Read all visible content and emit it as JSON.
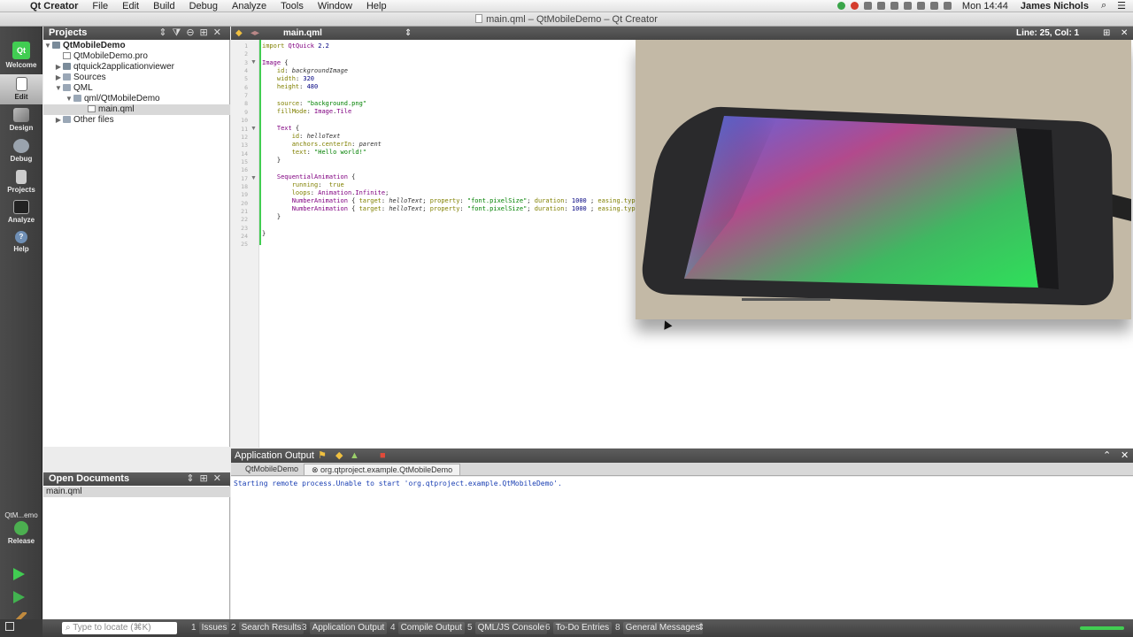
{
  "menubar": {
    "app": "Qt Creator",
    "items": [
      "File",
      "Edit",
      "Build",
      "Debug",
      "Analyze",
      "Tools",
      "Window",
      "Help"
    ],
    "clock": "Mon 14:44",
    "user": "James Nichols"
  },
  "window": {
    "title": "main.qml – QtMobileDemo – Qt Creator"
  },
  "modes": [
    {
      "label": "Welcome"
    },
    {
      "label": "Edit"
    },
    {
      "label": "Design"
    },
    {
      "label": "Debug"
    },
    {
      "label": "Projects"
    },
    {
      "label": "Analyze"
    },
    {
      "label": "Help"
    }
  ],
  "kit": {
    "project": "QtM...emo",
    "config": "Release"
  },
  "projects_pane": {
    "title": "Projects",
    "tree": [
      {
        "label": "QtMobileDemo",
        "bold": true
      },
      {
        "label": "QtMobileDemo.pro"
      },
      {
        "label": "qtquick2applicationviewer"
      },
      {
        "label": "Sources"
      },
      {
        "label": "QML"
      },
      {
        "label": "qml/QtMobileDemo"
      },
      {
        "label": "main.qml"
      },
      {
        "label": "Other files"
      }
    ]
  },
  "open_documents": {
    "title": "Open Documents",
    "items": [
      "main.qml"
    ]
  },
  "editor": {
    "filename": "main.qml",
    "position": "Line: 25, Col: 1",
    "line_count": 25
  },
  "output": {
    "title": "Application Output",
    "tabs": [
      "QtMobileDemo",
      "org.qtproject.example.QtMobileDemo"
    ],
    "text": "Starting remote process.Unable to start 'org.qtproject.example.QtMobileDemo'."
  },
  "statusbar": {
    "locator_placeholder": "Type to locate (⌘K)",
    "panes": [
      {
        "n": "1",
        "label": "Issues"
      },
      {
        "n": "2",
        "label": "Search Results"
      },
      {
        "n": "3",
        "label": "Application Output"
      },
      {
        "n": "4",
        "label": "Compile Output"
      },
      {
        "n": "5",
        "label": "QML/JS Console"
      },
      {
        "n": "6",
        "label": "To-Do Entries"
      },
      {
        "n": "8",
        "label": "General Messages"
      }
    ]
  }
}
